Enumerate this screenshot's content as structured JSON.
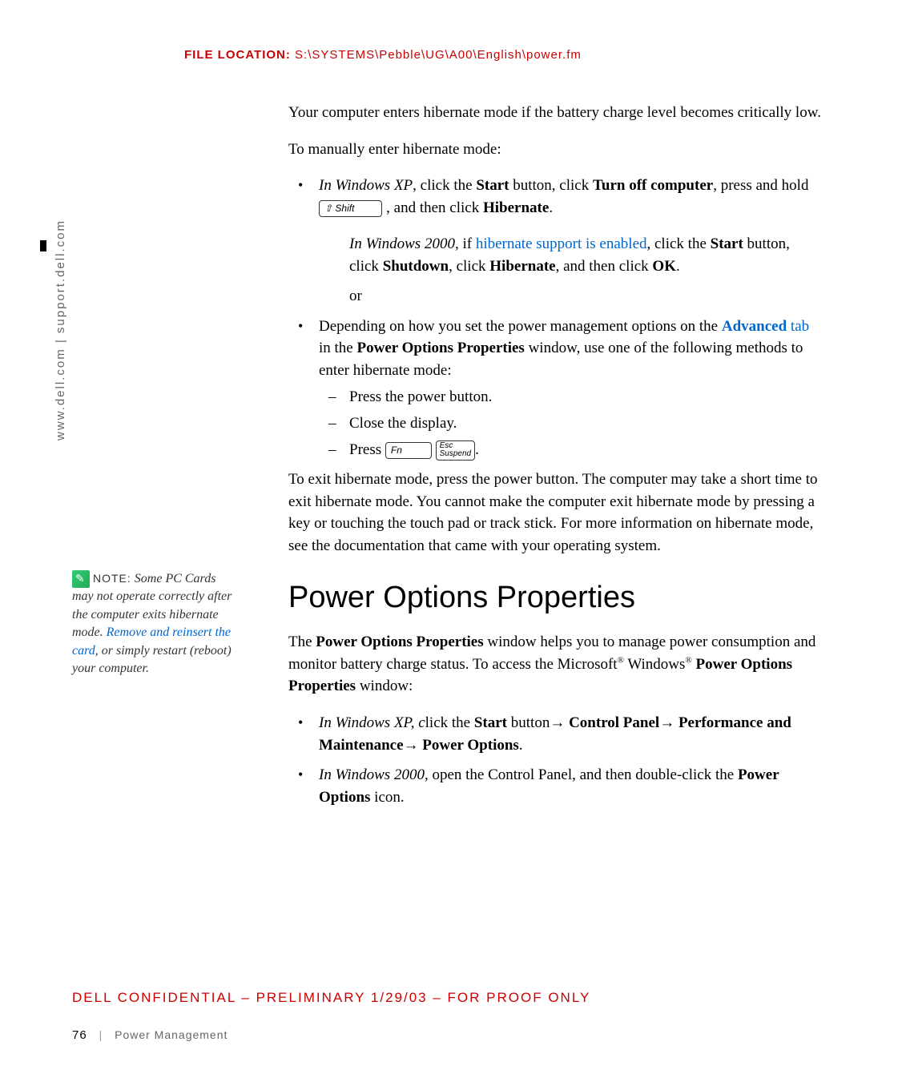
{
  "header": {
    "file_location_label": "FILE LOCATION:",
    "file_location_path": "S:\\SYSTEMS\\Pebble\\UG\\A00\\English\\power.fm"
  },
  "sidebar": {
    "url_text": "www.dell.com | support.dell.com"
  },
  "body": {
    "p1": "Your computer enters hibernate mode if the battery charge level becomes critically low.",
    "p2": "To manually enter hibernate mode:",
    "b1_pre": "In Windows XP",
    "b1_mid1": ", click the ",
    "b1_bold1": "Start",
    "b1_mid2": " button, click ",
    "b1_bold2": "Turn off computer",
    "b1_mid3": ", press and hold ",
    "b1_key_shift": "⇧ Shift",
    "b1_mid4": " , and then click ",
    "b1_bold3": "Hibernate",
    "b1_end": ".",
    "b1b_pre": "In Windows 2000",
    "b1b_mid1": ", if ",
    "b1b_link": "hibernate support is enabled",
    "b1b_mid2": ", click the ",
    "b1b_bold1": "Start",
    "b1b_mid3": " button, click ",
    "b1b_bold2": "Shutdown",
    "b1b_mid4": ", click ",
    "b1b_bold3": "Hibernate",
    "b1b_mid5": ", and then click ",
    "b1b_bold4": "OK",
    "b1b_end": ".",
    "b1b_or": "or",
    "b2_mid1": "Depending on how you set the power management options on the ",
    "b2_link": "Advanced",
    "b2_link2": " tab",
    "b2_mid2": " in the ",
    "b2_bold1": "Power Options Properties",
    "b2_mid3": " window, use one of the following methods to enter hibernate mode:",
    "d1": "Press the power button.",
    "d2": "Close the display.",
    "d3_pre": "Press ",
    "d3_key_fn": "Fn",
    "d3_key_esc_top": "Esc",
    "d3_key_esc_bot": "Suspend",
    "d3_end": ".",
    "p3": "To exit hibernate mode, press the power button. The computer may take a short time to exit hibernate mode. You cannot make the computer exit hibernate mode by pressing a key or touching the touch pad or track stick. For more information on hibernate mode, see the documentation that came with your operating system.",
    "h1": "Power Options Properties",
    "p4_pre": "The ",
    "p4_bold1": "Power Options Properties",
    "p4_mid": " window helps you to manage power consumption and monitor battery charge status. To access the Microsoft",
    "p4_reg": "®",
    "p4_mid2": " Windows",
    "p4_bold2": " Power Options Properties",
    "p4_end": " window:",
    "c1_pre": "In Windows XP, c",
    "c1_mid1": "lick the ",
    "c1_bold1": "Start",
    "c1_mid2": " button",
    "c1_arrow": "→",
    "c1_bold2": " Control Panel",
    "c1_bold3": " Performance and Maintenance",
    "c1_bold4": " Power Options",
    "c1_end": ".",
    "c2_pre": "In Windows 2000",
    "c2_mid1": ", open the Control Panel, and then double-click the ",
    "c2_bold1": "Power Options",
    "c2_end": " icon."
  },
  "note": {
    "label": "NOTE:",
    "text_pre": " Some PC Cards may not operate correctly after the computer exits hibernate mode. ",
    "link": "Remove and reinsert the card",
    "text_post": ", or simply restart (reboot) your computer."
  },
  "footer": {
    "confidential": "DELL CONFIDENTIAL – PRELIMINARY 1/29/03 – FOR PROOF ONLY",
    "page_num": "76",
    "section": "Power Management"
  }
}
